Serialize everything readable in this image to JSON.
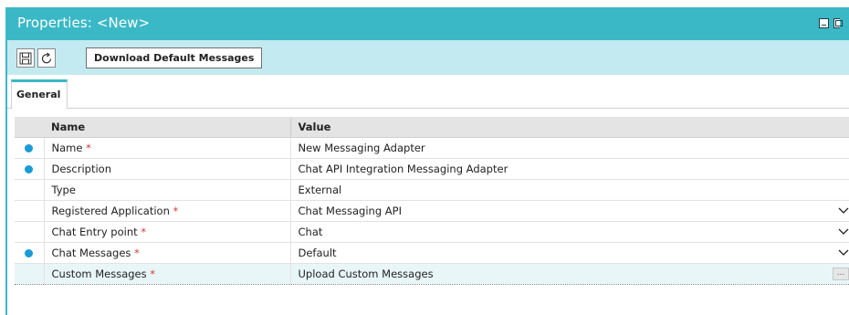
{
  "window": {
    "title": "Properties: <New>"
  },
  "toolbar": {
    "save_icon": "save-icon",
    "refresh_icon": "refresh-icon",
    "download_label": "Download Default Messages"
  },
  "tabs": [
    {
      "label": "General",
      "active": true
    }
  ],
  "grid": {
    "headers": {
      "name": "Name",
      "value": "Value"
    },
    "rows": [
      {
        "indicator": true,
        "name": "Name",
        "required": true,
        "value": "New Messaging Adapter",
        "control": "text"
      },
      {
        "indicator": true,
        "name": "Description",
        "required": false,
        "value": "Chat API Integration Messaging Adapter",
        "control": "text"
      },
      {
        "indicator": false,
        "name": "Type",
        "required": false,
        "value": "External",
        "control": "readonly"
      },
      {
        "indicator": false,
        "name": "Registered Application",
        "required": true,
        "value": "Chat Messaging API",
        "control": "dropdown"
      },
      {
        "indicator": false,
        "name": "Chat Entry point",
        "required": true,
        "value": "Chat",
        "control": "dropdown"
      },
      {
        "indicator": true,
        "name": "Chat Messages",
        "required": true,
        "value": "Default",
        "control": "dropdown"
      },
      {
        "indicator": false,
        "name": "Custom Messages",
        "required": true,
        "value": "Upload Custom Messages",
        "control": "browse",
        "selected": true
      }
    ],
    "required_marker": "*",
    "browse_label": "..."
  },
  "colors": {
    "accent": "#3bb8c6",
    "toolbar_bg": "#c3eaf0",
    "indicator": "#1a9bd7",
    "required": "#d23a3a"
  }
}
